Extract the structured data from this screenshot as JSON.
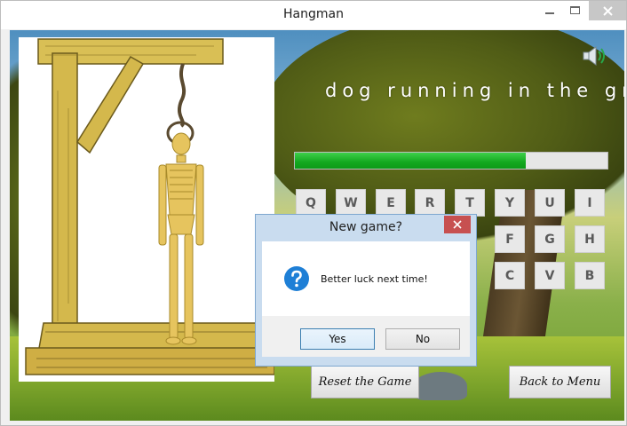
{
  "window": {
    "title": "Hangman"
  },
  "game": {
    "phrase": "dog running in the gra",
    "progress_fraction": 0.74,
    "keyboard": {
      "row1": [
        "Q",
        "W",
        "E",
        "R",
        "T",
        "Y",
        "U",
        "I"
      ],
      "row2_visible": [
        "F",
        "G",
        "H"
      ],
      "row3_visible": [
        "C",
        "V",
        "B"
      ]
    },
    "buttons": {
      "reset": "Reset the Game",
      "menu": "Back to Menu"
    },
    "speaker_icon": "speaker-icon"
  },
  "dialog": {
    "title": "New game?",
    "message": "Better luck next time!",
    "yes": "Yes",
    "no": "No",
    "icon": "question-icon",
    "colors": {
      "accent": "#1e7fd6"
    }
  }
}
